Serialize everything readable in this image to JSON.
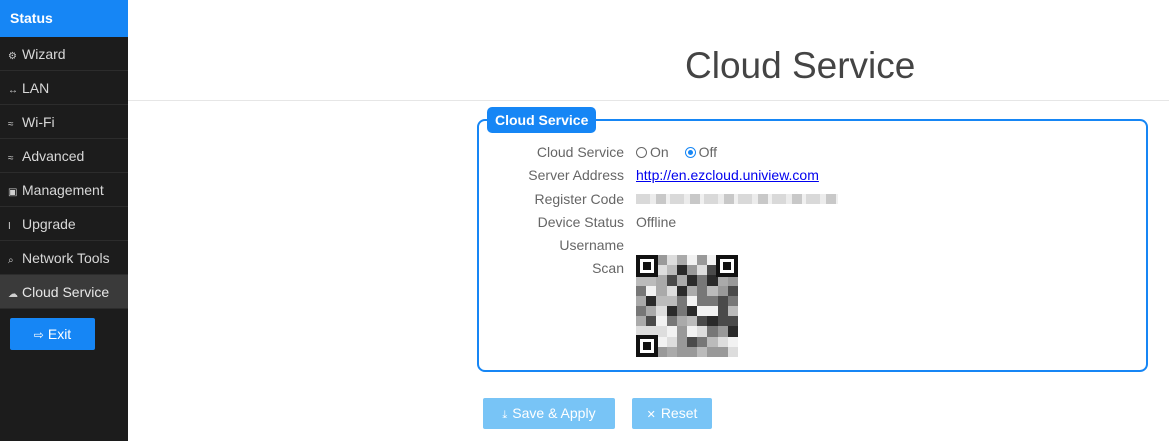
{
  "sidebar": {
    "status": "Status",
    "items": [
      {
        "icon": "⚙",
        "label": "Wizard",
        "active": false
      },
      {
        "icon": "↔",
        "label": "LAN",
        "active": false
      },
      {
        "icon": "≈",
        "label": "Wi-Fi",
        "active": false
      },
      {
        "icon": "≈",
        "label": "Advanced",
        "active": false
      },
      {
        "icon": "▣",
        "label": "Management",
        "active": false
      },
      {
        "icon": "I",
        "label": "Upgrade",
        "active": false
      },
      {
        "icon": "⌕",
        "label": "Network Tools",
        "active": false
      },
      {
        "icon": "☁",
        "label": "Cloud Service",
        "active": true
      }
    ],
    "exit_label": "Exit",
    "exit_icon": "⇨"
  },
  "header": {
    "title": "Cloud Service"
  },
  "section": {
    "legend": "Cloud Service",
    "fields": {
      "cloud_service_label": "Cloud Service",
      "option_on": "On",
      "option_off": "Off",
      "selected": "Off",
      "server_address_label": "Server Address",
      "server_address_value": "http://en.ezcloud.uniview.com",
      "register_code_label": "Register Code",
      "device_status_label": "Device Status",
      "device_status_value": "Offline",
      "username_label": "Username",
      "username_value": "",
      "scan_label": "Scan"
    }
  },
  "actions": {
    "save_label": "Save & Apply",
    "save_icon": "⤓",
    "reset_label": "Reset",
    "reset_icon": "✕"
  },
  "colors": {
    "accent": "#1686f5",
    "button_disabled": "#78c4f6",
    "sidebar_bg": "#1c1c1c"
  }
}
